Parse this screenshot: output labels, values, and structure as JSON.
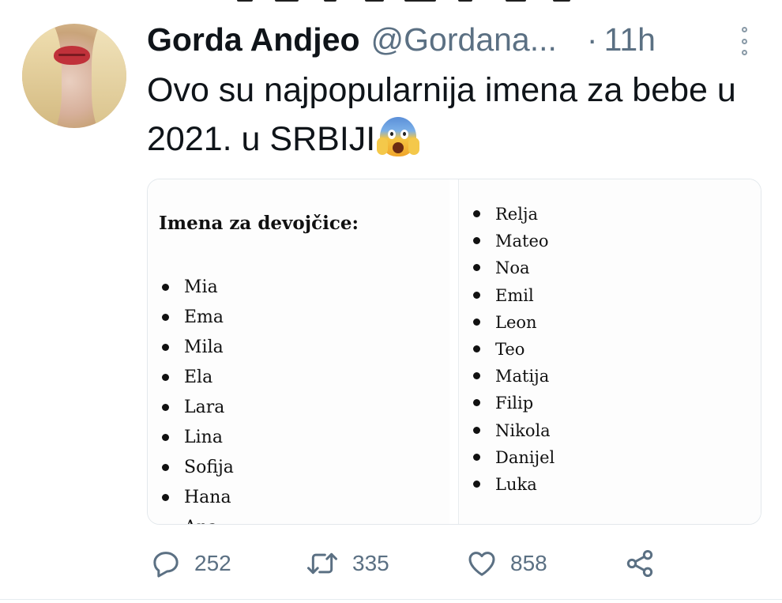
{
  "tweet": {
    "author_name": "Gorda Andjeo",
    "author_handle": "@Gordana...",
    "separator": "·",
    "time": "11h",
    "text": "Ovo su najpopularnija imena za bebe u 2021. u SRBIJI",
    "emoji": "face-screaming-in-fear"
  },
  "media": {
    "left": {
      "heading": "Imena za devojčice:",
      "names": [
        "Mia",
        "Ema",
        "Mila",
        "Ela",
        "Lara",
        "Lina",
        "Sofija",
        "Hana",
        "Ana"
      ]
    },
    "right": {
      "names": [
        "Relja",
        "Mateo",
        "Noa",
        "Emil",
        "Leon",
        "Teo",
        "Matija",
        "Filip",
        "Nikola",
        "Danijel",
        "Luka"
      ]
    }
  },
  "actions": {
    "replies": "252",
    "retweets": "335",
    "likes": "858"
  },
  "colors": {
    "text": "#0f1419",
    "secondary": "#5b7083",
    "border": "#e3e8ec"
  }
}
